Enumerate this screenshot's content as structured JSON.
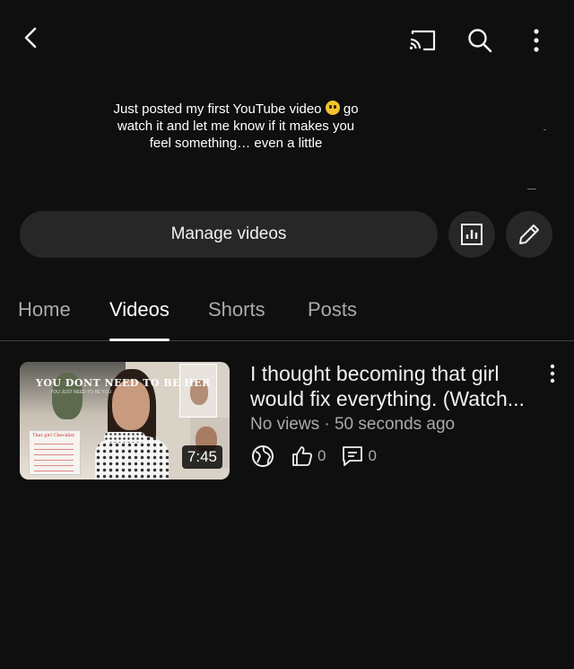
{
  "topbar": {
    "back_icon": "chevron-left-icon",
    "cast_icon": "cast-icon",
    "search_icon": "search-icon",
    "more_icon": "more-vertical-icon"
  },
  "channel": {
    "bio_line1": "Just posted my first YouTube video",
    "bio_line1_end": "go",
    "bio_line2": "watch it and let me know if it makes you",
    "bio_line3": "feel something… even a little",
    "bio_emoji": "pleading-face-emoji"
  },
  "actions": {
    "manage_label": "Manage videos",
    "analytics_icon": "analytics-icon",
    "edit_icon": "pencil-icon"
  },
  "tabs": [
    {
      "label": "Home",
      "active": false
    },
    {
      "label": "Videos",
      "active": true
    },
    {
      "label": "Shorts",
      "active": false
    },
    {
      "label": "Posts",
      "active": false
    }
  ],
  "video": {
    "title_line1": "I thought becoming that girl",
    "title_line2": "would fix everything. (Watch...",
    "meta": "No views · 50 seconds ago",
    "duration": "7:45",
    "visibility_icon": "globe-icon",
    "likes": "0",
    "comments": "0",
    "thumbnail": {
      "headline": "YOU DONT NEED TO BE HER",
      "subline": "YOU JUST NEED TO BE YOU",
      "checklist_title": "That girl Checklist"
    }
  },
  "colors": {
    "background": "#0f0f0f",
    "surface": "#272727",
    "text_primary": "#f1f1f1",
    "text_secondary": "#aaaaaa"
  }
}
